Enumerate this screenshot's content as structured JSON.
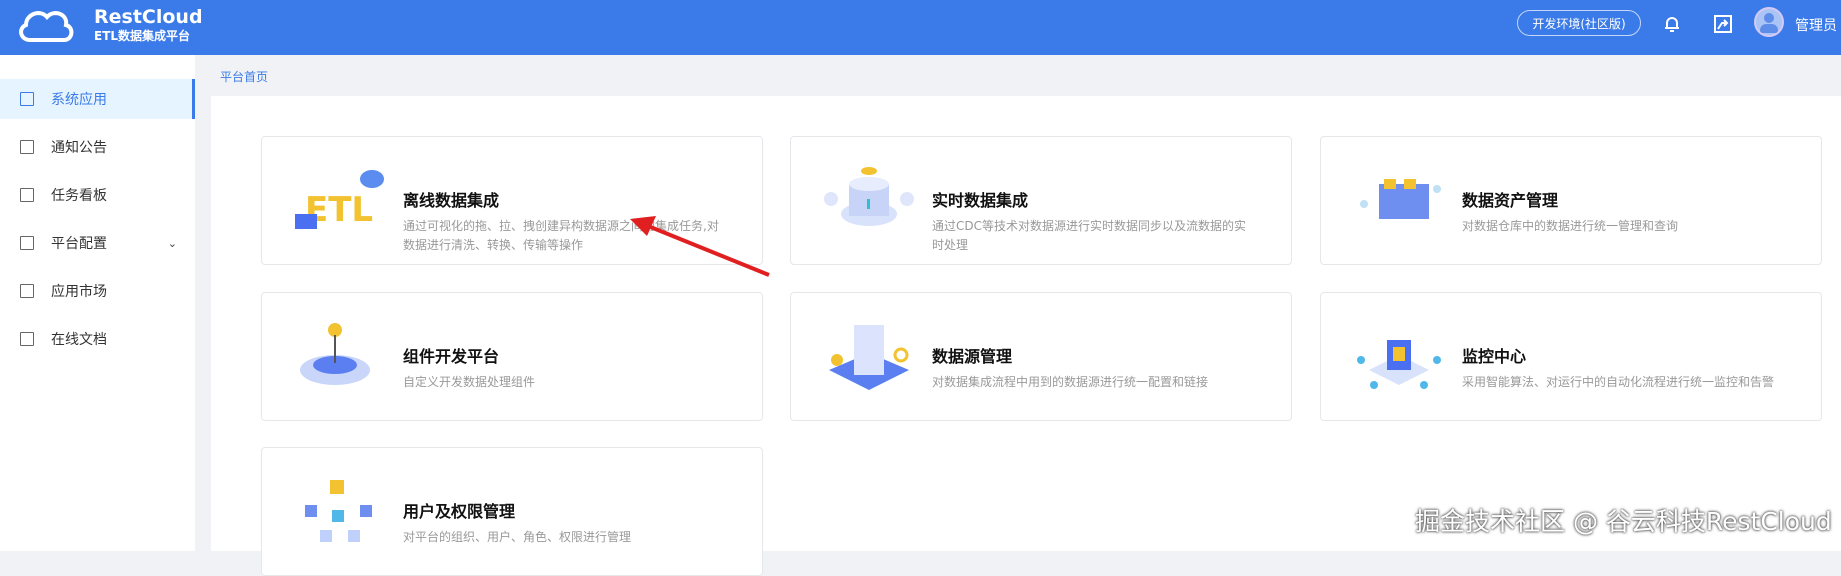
{
  "header": {
    "logo_title": "RestCloud",
    "logo_subtitle": "ETL数据集成平台",
    "env_label": "开发环境(社区版)",
    "user_name": "管理员",
    "icons": [
      "bell-icon",
      "share-icon"
    ]
  },
  "sidebar": {
    "items": [
      {
        "label": "系统应用",
        "icon": "grid-icon",
        "active": true
      },
      {
        "label": "通知公告",
        "icon": "megaphone-icon"
      },
      {
        "label": "任务看板",
        "icon": "board-icon"
      },
      {
        "label": "平台配置",
        "icon": "terminal-icon",
        "expandable": true
      },
      {
        "label": "应用市场",
        "icon": "grid-icon"
      },
      {
        "label": "在线文档",
        "icon": "document-icon"
      }
    ]
  },
  "breadcrumb": "平台首页",
  "cards": [
    {
      "title": "离线数据集成",
      "desc": "通过可视化的拖、拉、拽创建异构数据源之间的集成任务,对数据进行清洗、转换、传输等操作"
    },
    {
      "title": "实时数据集成",
      "desc": "通过CDC等技术对数据源进行实时数据同步以及流数据的实时处理"
    },
    {
      "title": "数据资产管理",
      "desc": "对数据仓库中的数据进行统一管理和查询"
    },
    {
      "title": "组件开发平台",
      "desc": "自定义开发数据处理组件"
    },
    {
      "title": "数据源管理",
      "desc": "对数据集成流程中用到的数据源进行统一配置和链接"
    },
    {
      "title": "监控中心",
      "desc": "采用智能算法、对运行中的自动化流程进行统一监控和告警"
    },
    {
      "title": "用户及权限管理",
      "desc": "对平台的组织、用户、角色、权限进行管理"
    }
  ],
  "watermark": "掘金技术社区 @ 谷云科技RestCloud",
  "colors": {
    "primary": "#3b7be9",
    "annotation_arrow": "#e02020"
  }
}
